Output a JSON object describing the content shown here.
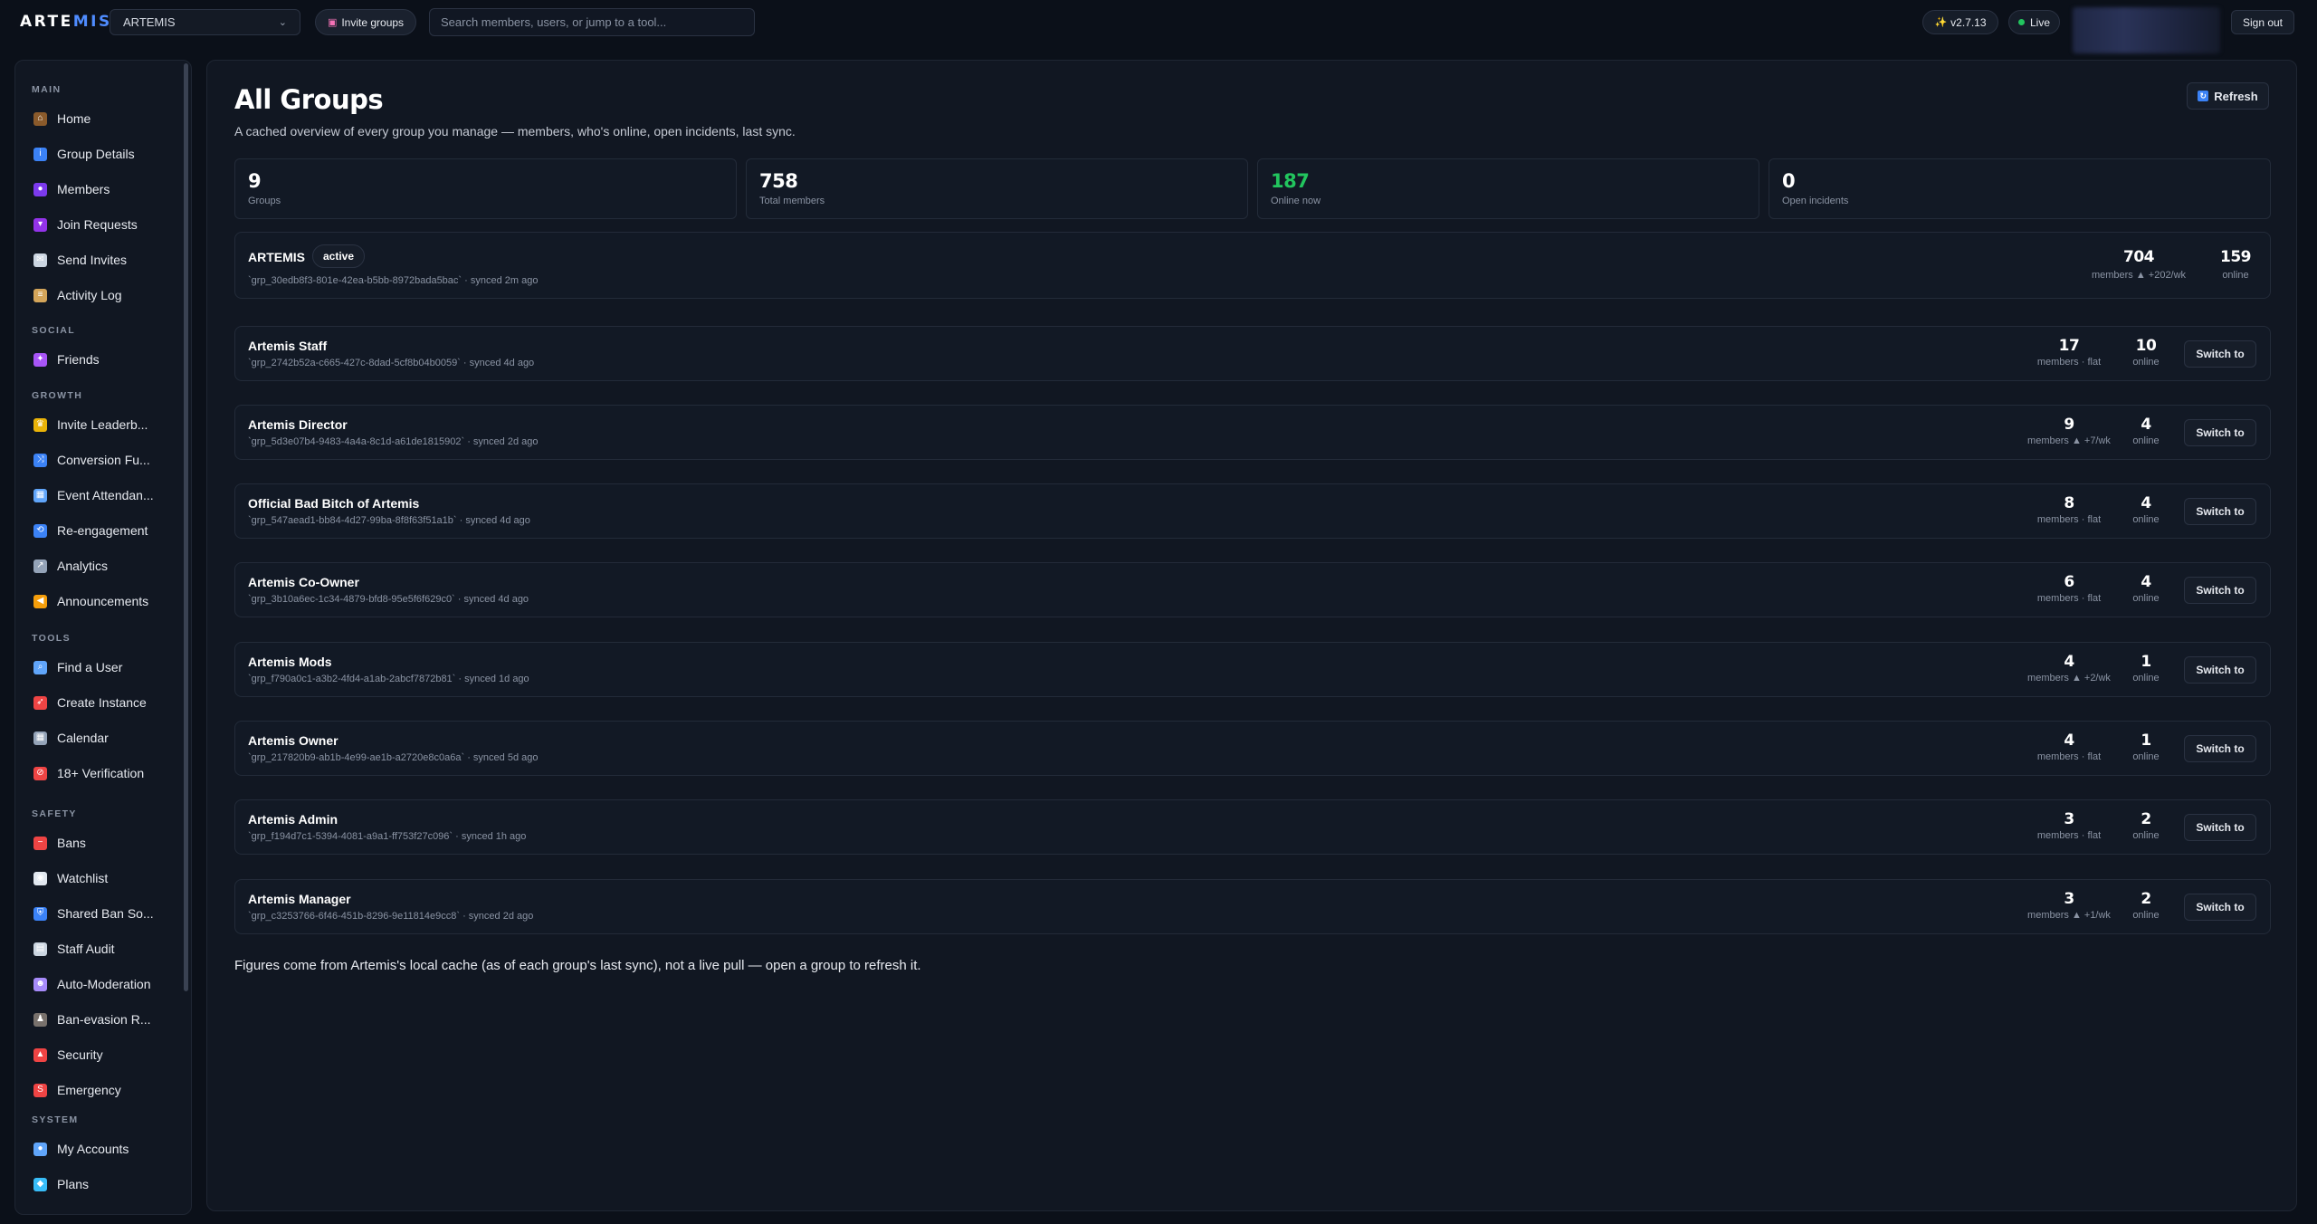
{
  "header": {
    "logo_main": "ARTE",
    "logo_accent": "MIS",
    "group_select_value": "ARTEMIS",
    "invite_label": "Invite groups",
    "search_placeholder": "Search members, users, or jump to a tool...",
    "version": "v2.7.13",
    "live": "Live",
    "sign_out": "Sign out"
  },
  "sidebar": {
    "sections": [
      {
        "title": "MAIN",
        "items": [
          {
            "label": "Home",
            "icon": "house-icon",
            "color": "#8a5a2b"
          },
          {
            "label": "Group Details",
            "icon": "info-icon",
            "color": "#3b82f6"
          },
          {
            "label": "Members",
            "icon": "people-icon",
            "color": "#7c3aed"
          },
          {
            "label": "Join Requests",
            "icon": "inbox-icon",
            "color": "#9333ea"
          },
          {
            "label": "Send Invites",
            "icon": "envelope-icon",
            "color": "#cbd5e1"
          },
          {
            "label": "Activity Log",
            "icon": "scroll-icon",
            "color": "#d4a55a"
          }
        ]
      },
      {
        "title": "SOCIAL",
        "items": [
          {
            "label": "Friends",
            "icon": "handshake-icon",
            "color": "#a855f7"
          }
        ]
      },
      {
        "title": "GROWTH",
        "items": [
          {
            "label": "Invite Leaderb...",
            "icon": "trophy-icon",
            "color": "#eab308"
          },
          {
            "label": "Conversion Fu...",
            "icon": "shuffle-icon",
            "color": "#3b82f6"
          },
          {
            "label": "Event Attendan...",
            "icon": "calendar-icon",
            "color": "#60a5fa"
          },
          {
            "label": "Re-engagement",
            "icon": "repeat-icon",
            "color": "#3b82f6"
          },
          {
            "label": "Analytics",
            "icon": "chart-icon",
            "color": "#94a3b8"
          },
          {
            "label": "Announcements",
            "icon": "megaphone-icon",
            "color": "#f59e0b"
          }
        ]
      },
      {
        "title": "TOOLS",
        "items": [
          {
            "label": "Find a User",
            "icon": "magnifier-icon",
            "color": "#60a5fa"
          },
          {
            "label": "Create Instance",
            "icon": "rocket-icon",
            "color": "#ef4444"
          },
          {
            "label": "Calendar",
            "icon": "calendar-icon",
            "color": "#94a3b8"
          },
          {
            "label": "18+ Verification",
            "icon": "no-under-18-icon",
            "color": "#ef4444"
          }
        ]
      },
      {
        "title": "SAFETY",
        "items": [
          {
            "label": "Bans",
            "icon": "no-entry-icon",
            "color": "#ef4444"
          },
          {
            "label": "Watchlist",
            "icon": "eye-icon",
            "color": "#e2e8f0"
          },
          {
            "label": "Shared Ban So...",
            "icon": "shield-icon",
            "color": "#3b82f6"
          },
          {
            "label": "Staff Audit",
            "icon": "clipboard-icon",
            "color": "#cbd5e1"
          },
          {
            "label": "Auto-Moderation",
            "icon": "robot-icon",
            "color": "#a78bfa"
          },
          {
            "label": "Ban-evasion R...",
            "icon": "detective-icon",
            "color": "#78716c"
          },
          {
            "label": "Security",
            "icon": "siren-icon",
            "color": "#ef4444"
          },
          {
            "label": "Emergency",
            "icon": "sos-icon",
            "color": "#ef4444"
          }
        ]
      },
      {
        "title": "SYSTEM",
        "items": [
          {
            "label": "My Accounts",
            "icon": "user-icon",
            "color": "#60a5fa"
          },
          {
            "label": "Plans",
            "icon": "gem-icon",
            "color": "#38bdf8"
          }
        ]
      }
    ]
  },
  "main": {
    "title": "All Groups",
    "subtitle": "A cached overview of every group you manage — members, who's online, open incidents, last sync.",
    "refresh_label": "Refresh",
    "stats": [
      {
        "value": "9",
        "label": "Groups",
        "highlight": false
      },
      {
        "value": "758",
        "label": "Total members",
        "highlight": false
      },
      {
        "value": "187",
        "label": "Online now",
        "highlight": true
      },
      {
        "value": "0",
        "label": "Open incidents",
        "highlight": false
      }
    ],
    "current_group": {
      "name": "ARTEMIS",
      "badge": "active",
      "meta": "`grp_30edb8f3-801e-42ea-b5bb-8972bada5bac` · synced 2m ago",
      "members": "704",
      "members_sub": "members ▲ +202/wk",
      "online": "159",
      "online_sub": "online"
    },
    "groups": [
      {
        "name": "Artemis Staff",
        "meta": "`grp_2742b52a-c665-427c-8dad-5cf8b04b0059` · synced 4d ago",
        "members": "17",
        "members_sub": "members · flat",
        "online": "10",
        "online_sub": "online",
        "action": "Switch to"
      },
      {
        "name": "Artemis Director",
        "meta": "`grp_5d3e07b4-9483-4a4a-8c1d-a61de1815902` · synced 2d ago",
        "members": "9",
        "members_sub": "members ▲ +7/wk",
        "online": "4",
        "online_sub": "online",
        "action": "Switch to"
      },
      {
        "name": "Official Bad Bitch of Artemis",
        "meta": "`grp_547aead1-bb84-4d27-99ba-8f8f63f51a1b` · synced 4d ago",
        "members": "8",
        "members_sub": "members · flat",
        "online": "4",
        "online_sub": "online",
        "action": "Switch to"
      },
      {
        "name": "Artemis Co-Owner",
        "meta": "`grp_3b10a6ec-1c34-4879-bfd8-95e5f6f629c0` · synced 4d ago",
        "members": "6",
        "members_sub": "members · flat",
        "online": "4",
        "online_sub": "online",
        "action": "Switch to"
      },
      {
        "name": "Artemis Mods",
        "meta": "`grp_f790a0c1-a3b2-4fd4-a1ab-2abcf7872b81` · synced 1d ago",
        "members": "4",
        "members_sub": "members ▲ +2/wk",
        "online": "1",
        "online_sub": "online",
        "action": "Switch to"
      },
      {
        "name": "Artemis Owner",
        "meta": "`grp_217820b9-ab1b-4e99-ae1b-a2720e8c0a6a` · synced 5d ago",
        "members": "4",
        "members_sub": "members · flat",
        "online": "1",
        "online_sub": "online",
        "action": "Switch to"
      },
      {
        "name": "Artemis Admin",
        "meta": "`grp_f194d7c1-5394-4081-a9a1-ff753f27c096` · synced 1h ago",
        "members": "3",
        "members_sub": "members · flat",
        "online": "2",
        "online_sub": "online",
        "action": "Switch to"
      },
      {
        "name": "Artemis Manager",
        "meta": "`grp_c3253766-6f46-451b-8296-9e11814e9cc8` · synced 2d ago",
        "members": "3",
        "members_sub": "members ▲ +1/wk",
        "online": "2",
        "online_sub": "online",
        "action": "Switch to"
      }
    ],
    "footnote": "Figures come from Artemis's local cache (as of each group's last sync), not a live pull — open a group to refresh it."
  }
}
